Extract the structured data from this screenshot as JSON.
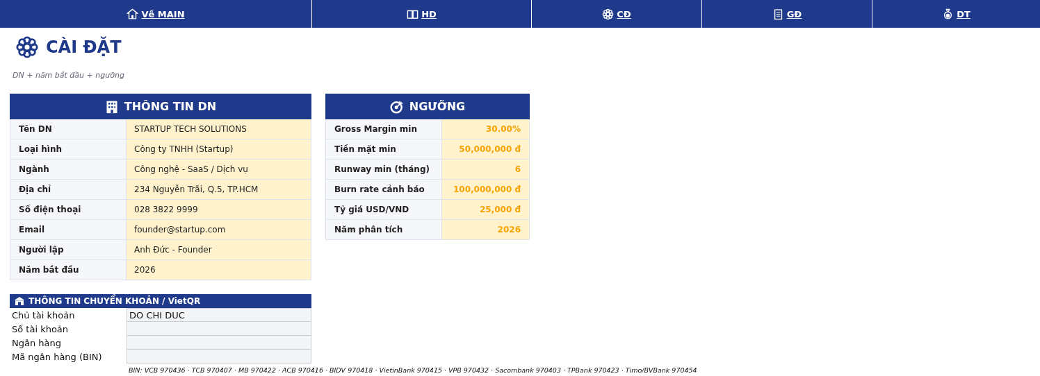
{
  "nav": [
    {
      "label": "Về MAIN"
    },
    {
      "label": "HD"
    },
    {
      "label": "CĐ"
    },
    {
      "label": "GĐ"
    },
    {
      "label": "DT"
    }
  ],
  "page": {
    "title": "CÀI ĐẶT",
    "subtitle": "DN + năm bắt đầu + ngưỡng"
  },
  "company_info": {
    "title": "THÔNG TIN DN",
    "rows": [
      {
        "label": "Tên DN",
        "value": "STARTUP TECH SOLUTIONS"
      },
      {
        "label": "Loại hình",
        "value": "Công ty TNHH (Startup)"
      },
      {
        "label": "Ngành",
        "value": "Công nghệ - SaaS / Dịch vụ"
      },
      {
        "label": "Địa chỉ",
        "value": "234 Nguyễn Trãi, Q.5, TP.HCM"
      },
      {
        "label": "Số điện thoại",
        "value": "028 3822 9999"
      },
      {
        "label": "Email",
        "value": "founder@startup.com"
      },
      {
        "label": "Người lập",
        "value": "Anh Đức - Founder"
      },
      {
        "label": "Năm bắt đầu",
        "value": "2026"
      }
    ]
  },
  "thresholds": {
    "title": "NGƯỠNG",
    "rows": [
      {
        "label": "Gross Margin min",
        "value": "30.00%"
      },
      {
        "label": "Tiền mặt min",
        "value": "50,000,000 đ"
      },
      {
        "label": "Runway min (tháng)",
        "value": "6"
      },
      {
        "label": "Burn rate cảnh báo",
        "value": "100,000,000 đ"
      },
      {
        "label": "Tỷ giá USD/VND",
        "value": "25,000 đ"
      },
      {
        "label": "Năm phân tích",
        "value": "2026"
      }
    ]
  },
  "bank_transfer": {
    "title": "THÔNG TIN CHUYỂN KHOẢN / VietQR",
    "rows": [
      {
        "label": "Chủ tài khoản",
        "value": "DO CHI DUC"
      },
      {
        "label": "Số tài khoản"
      },
      {
        "label": "Ngân hàng"
      },
      {
        "label": "Mã ngân hàng (BIN)"
      }
    ],
    "note": "BIN: VCB 970436 · TCB 970407 · MB 970422 · ACB 970416 · BIDV 970418 · VietinBank 970415 · VPB 970432 · Sacombank 970403 · TPBank 970423 · Timo/BVBank 970454"
  }
}
